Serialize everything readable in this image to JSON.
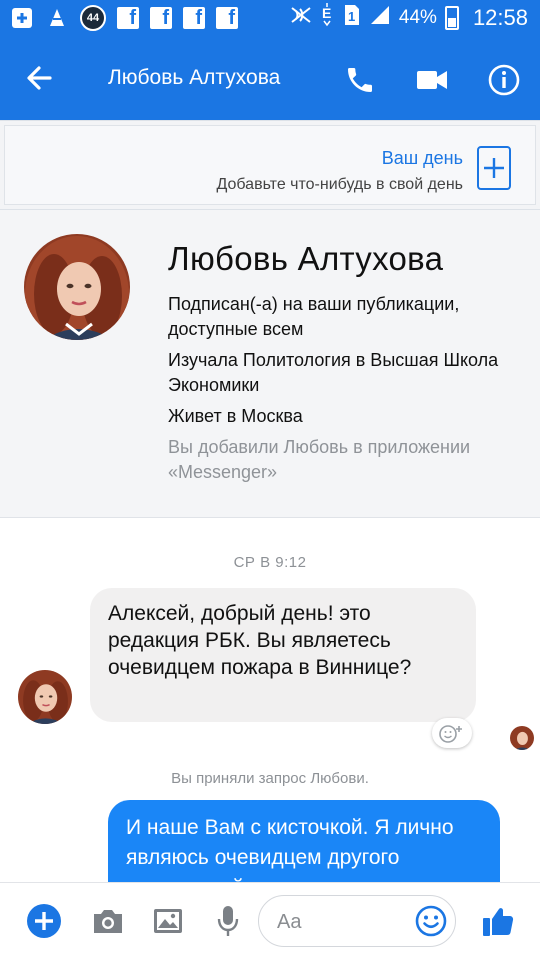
{
  "status_bar": {
    "badge": "44",
    "battery": "44%",
    "time": "12:58"
  },
  "header": {
    "title": "Любовь Алтухова"
  },
  "your_day": {
    "title": "Ваш день",
    "subtitle": "Добавьте что-нибудь в свой день"
  },
  "profile": {
    "name": "Любовь Алтухова",
    "follow_info": "Подписан(-а) на ваши публикации, доступные всем",
    "education": "Изучала Политология в Высшая Школа Экономики",
    "location": "Живет в Москва",
    "added_note": "Вы добавили Любовь в приложении «Messenger»"
  },
  "chat": {
    "timestamp": "СР В 9:12",
    "incoming_message": "Алексей, добрый день! это редакция РБК. Вы являетесь очевидцем пожара в Виннице?",
    "system_note": "Вы приняли запрос Любови.",
    "outgoing_message": "И наше Вам с кисточкой. Я лично являюсь очевидцем другого пожара, войны"
  },
  "composer": {
    "placeholder": "Aa"
  },
  "colors": {
    "brand_blue": "#1b76e3",
    "outgoing_bubble": "#1a86f7",
    "incoming_bubble": "#f1f0f0"
  }
}
